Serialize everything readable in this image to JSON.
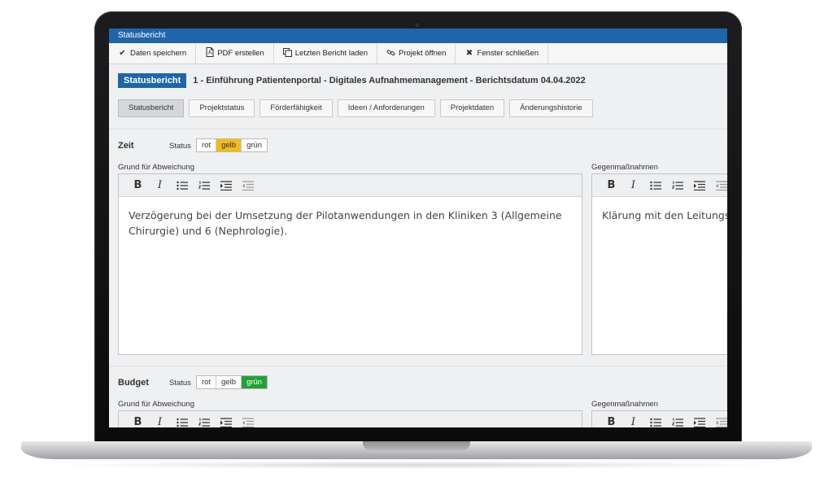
{
  "window": {
    "title": "Statusbericht"
  },
  "toolbar": {
    "items": [
      {
        "label": "Daten speichern",
        "icon": "checkmark-icon"
      },
      {
        "label": "PDF erstellen",
        "icon": "pdf-file-icon"
      },
      {
        "label": "Letzten Bericht laden",
        "icon": "copy-icon"
      },
      {
        "label": "Projekt öffnen",
        "icon": "link-icon"
      },
      {
        "label": "Fenster schließen",
        "icon": "close-icon"
      }
    ]
  },
  "header": {
    "badge": "Statusbericht",
    "title": "1 - Einführung Patientenportal - Digitales Aufnahmemanagement - Berichtsdatum 04.04.2022"
  },
  "tabs": [
    {
      "label": "Statusbericht",
      "active": true
    },
    {
      "label": "Projektstatus",
      "active": false
    },
    {
      "label": "Förderfähigkeit",
      "active": false
    },
    {
      "label": "Ideen / Anforderungen",
      "active": false
    },
    {
      "label": "Projektdaten",
      "active": false
    },
    {
      "label": "Änderungshistorie",
      "active": false
    }
  ],
  "sections": {
    "zeit": {
      "title": "Zeit",
      "status_label": "Status",
      "options": [
        "rot",
        "gelb",
        "grün"
      ],
      "selected": "gelb",
      "selected_color": "#f3bb18",
      "left_label": "Grund für Abweichung",
      "left_text": "Verzögerung bei der Umsetzung der Pilotanwendungen in den Kliniken 3 (Allgemeine Chirurgie) und 6 (Nephrologie).",
      "right_label": "Gegenmaßnahmen",
      "right_text": "Klärung mit den Leitungse"
    },
    "budget": {
      "title": "Budget",
      "status_label": "Status",
      "options": [
        "rot",
        "gelb",
        "grün"
      ],
      "selected": "grün",
      "selected_color": "#21a334",
      "left_label": "Grund für Abweichung",
      "right_label": "Gegenmaßnahmen"
    }
  },
  "colors": {
    "brand": "#1f65a8",
    "background": "#eff0f2"
  }
}
